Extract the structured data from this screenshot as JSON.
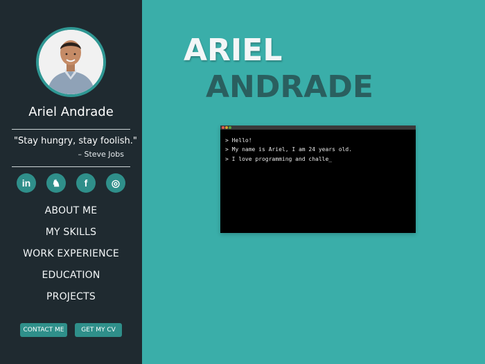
{
  "sidebar": {
    "name": "Ariel Andrade",
    "quote": "\"Stay hungry, stay foolish.\"",
    "quote_author": "– Steve Jobs",
    "socials": [
      {
        "icon": "linkedin-icon",
        "glyph": "in"
      },
      {
        "icon": "github-icon",
        "glyph": "♞"
      },
      {
        "icon": "facebook-icon",
        "glyph": "f"
      },
      {
        "icon": "instagram-icon",
        "glyph": "◎"
      }
    ],
    "nav": [
      {
        "label": "ABOUT ME"
      },
      {
        "label": "MY SKILLS"
      },
      {
        "label": "WORK EXPERIENCE"
      },
      {
        "label": "EDUCATION"
      },
      {
        "label": "PROJECTS"
      }
    ],
    "buttons": {
      "contact": "CONTACT ME",
      "cv": "GET MY CV"
    }
  },
  "main": {
    "headline_first": "ARIEL",
    "headline_last": "ANDRADE",
    "terminal": {
      "lines": [
        "> Hello!",
        "> My name is Ariel, I am 24 years old.",
        "> I love programming and challe_"
      ]
    }
  },
  "colors": {
    "background": "#3aaea9",
    "sidebar": "#1f2a30",
    "accent": "#2f8f8a",
    "headline_dark": "#2a5f5f"
  }
}
